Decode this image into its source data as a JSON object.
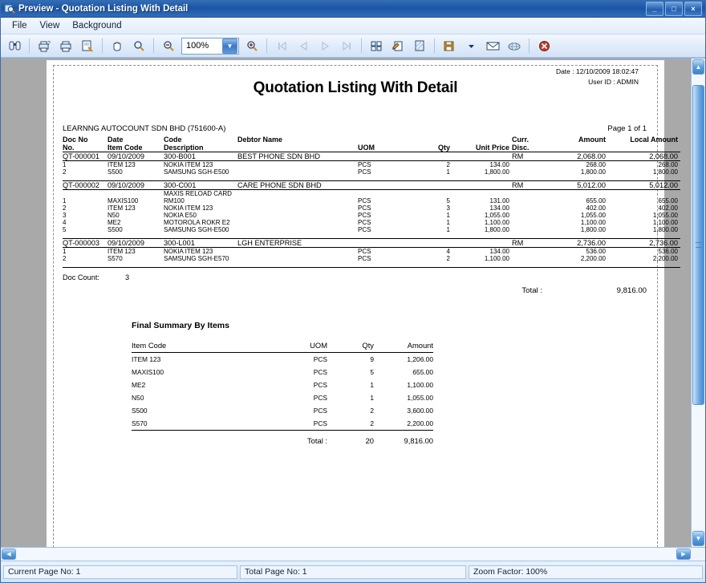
{
  "window": {
    "title": "Preview - Quotation Listing With Detail",
    "icon": "preview-magnifier-icon",
    "buttons": {
      "minimize": "_",
      "maximize": "□",
      "close": "×"
    }
  },
  "menu": [
    {
      "label": "File",
      "accel": "F"
    },
    {
      "label": "View",
      "accel": "V"
    },
    {
      "label": "Background",
      "accel": "B"
    }
  ],
  "toolbar": {
    "zoom_value": "100%",
    "buttons": [
      "find-binoculars-icon",
      "print-preview-icon",
      "print-icon",
      "page-setup-icon",
      "hand-pan-icon",
      "zoom-tool-icon",
      "zoom-out-icon",
      "zoom-in-icon",
      "first-page-icon",
      "previous-page-icon",
      "next-page-icon",
      "last-page-icon",
      "thumbnails-icon",
      "annotate-icon",
      "watermark-icon",
      "export-save-icon",
      "email-icon",
      "publish-web-icon",
      "close-preview-icon"
    ]
  },
  "report": {
    "meta": {
      "date_label": "Date :",
      "date_value": "12/10/2009 18:02:47",
      "user_label": "User ID :",
      "user_value": "ADMIN"
    },
    "title": "Quotation Listing With Detail",
    "company": "LEARNNG AUTOCOUNT SDN BHD (751600-A)",
    "page_indicator": "Page 1 of 1",
    "columns_top": [
      "Doc No",
      "Date",
      "Code",
      "Debtor Name",
      "",
      "",
      "",
      "Curr.",
      "Amount",
      "Local Amount"
    ],
    "columns_bottom": [
      "No.",
      "Item Code",
      "Description",
      "",
      "UOM",
      "Qty",
      "Unit Price",
      "Disc.",
      "",
      ""
    ],
    "documents": [
      {
        "doc_no": "QT-000001",
        "date": "09/10/2009",
        "code": "300-B001",
        "debtor": "BEST PHONE SDN BHD",
        "currency": "RM",
        "amount": "2,068.00",
        "local_amount": "2,068.00",
        "items": [
          {
            "no": "1",
            "item_code": "ITEM 123",
            "description": "NOKIA ITEM 123",
            "uom": "PCS",
            "qty": "2",
            "unit_price": "134.00",
            "amount": "268.00",
            "local_amount": "268.00"
          },
          {
            "no": "2",
            "item_code": "S500",
            "description": "SAMSUNG SGH-E500",
            "uom": "PCS",
            "qty": "1",
            "unit_price": "1,800.00",
            "amount": "1,800.00",
            "local_amount": "1,800.00"
          }
        ]
      },
      {
        "doc_no": "QT-000002",
        "date": "09/10/2009",
        "code": "300-C001",
        "debtor": "CARE PHONE SDN BHD",
        "currency": "RM",
        "amount": "5,012.00",
        "local_amount": "5,012.00",
        "items": [
          {
            "no": "1",
            "item_code": "MAXIS100",
            "description": "MAXIS RELOAD CARD RM100",
            "uom": "PCS",
            "qty": "5",
            "unit_price": "131.00",
            "amount": "655.00",
            "local_amount": "655.00"
          },
          {
            "no": "2",
            "item_code": "ITEM 123",
            "description": "NOKIA ITEM 123",
            "uom": "PCS",
            "qty": "3",
            "unit_price": "134.00",
            "amount": "402.00",
            "local_amount": "402.00"
          },
          {
            "no": "3",
            "item_code": "N50",
            "description": "NOKIA E50",
            "uom": "PCS",
            "qty": "1",
            "unit_price": "1,055.00",
            "amount": "1,055.00",
            "local_amount": "1,055.00"
          },
          {
            "no": "4",
            "item_code": "ME2",
            "description": "MOTOROLA ROKR E2",
            "uom": "PCS",
            "qty": "1",
            "unit_price": "1,100.00",
            "amount": "1,100.00",
            "local_amount": "1,100.00"
          },
          {
            "no": "5",
            "item_code": "S500",
            "description": "SAMSUNG SGH-E500",
            "uom": "PCS",
            "qty": "1",
            "unit_price": "1,800.00",
            "amount": "1,800.00",
            "local_amount": "1,800.00"
          }
        ]
      },
      {
        "doc_no": "QT-000003",
        "date": "09/10/2009",
        "code": "300-L001",
        "debtor": "LGH ENTERPRISE",
        "currency": "RM",
        "amount": "2,736.00",
        "local_amount": "2,736.00",
        "items": [
          {
            "no": "1",
            "item_code": "ITEM 123",
            "description": "NOKIA ITEM 123",
            "uom": "PCS",
            "qty": "4",
            "unit_price": "134.00",
            "amount": "536.00",
            "local_amount": "536.00"
          },
          {
            "no": "2",
            "item_code": "S570",
            "description": "SAMSUNG SGH-E570",
            "uom": "PCS",
            "qty": "2",
            "unit_price": "1,100.00",
            "amount": "2,200.00",
            "local_amount": "2,200.00"
          }
        ]
      }
    ],
    "doc_count_label": "Doc Count:",
    "doc_count_value": "3",
    "grand_total_label": "Total :",
    "grand_total_value": "9,816.00",
    "summary": {
      "title": "Final Summary By Items",
      "columns": [
        "Item Code",
        "UOM",
        "Qty",
        "Amount"
      ],
      "rows": [
        {
          "item_code": "ITEM 123",
          "uom": "PCS",
          "qty": "9",
          "amount": "1,206.00"
        },
        {
          "item_code": "MAXIS100",
          "uom": "PCS",
          "qty": "5",
          "amount": "655.00"
        },
        {
          "item_code": "ME2",
          "uom": "PCS",
          "qty": "1",
          "amount": "1,100.00"
        },
        {
          "item_code": "N50",
          "uom": "PCS",
          "qty": "1",
          "amount": "1,055.00"
        },
        {
          "item_code": "S500",
          "uom": "PCS",
          "qty": "2",
          "amount": "3,600.00"
        },
        {
          "item_code": "S570",
          "uom": "PCS",
          "qty": "2",
          "amount": "2,200.00"
        }
      ],
      "total_label": "Total :",
      "total_qty": "20",
      "total_amount": "9,816.00"
    }
  },
  "statusbar": {
    "current_page": "Current Page No: 1",
    "total_page": "Total Page No: 1",
    "zoom_factor": "Zoom Factor: 100%"
  },
  "colors": {
    "title_bar": "#1c55a3",
    "toolbar_bg": "#dfebf9",
    "page_bg": "#ffffff",
    "canvas_bg": "#a9a9a9",
    "accent": "#3a79c4"
  }
}
